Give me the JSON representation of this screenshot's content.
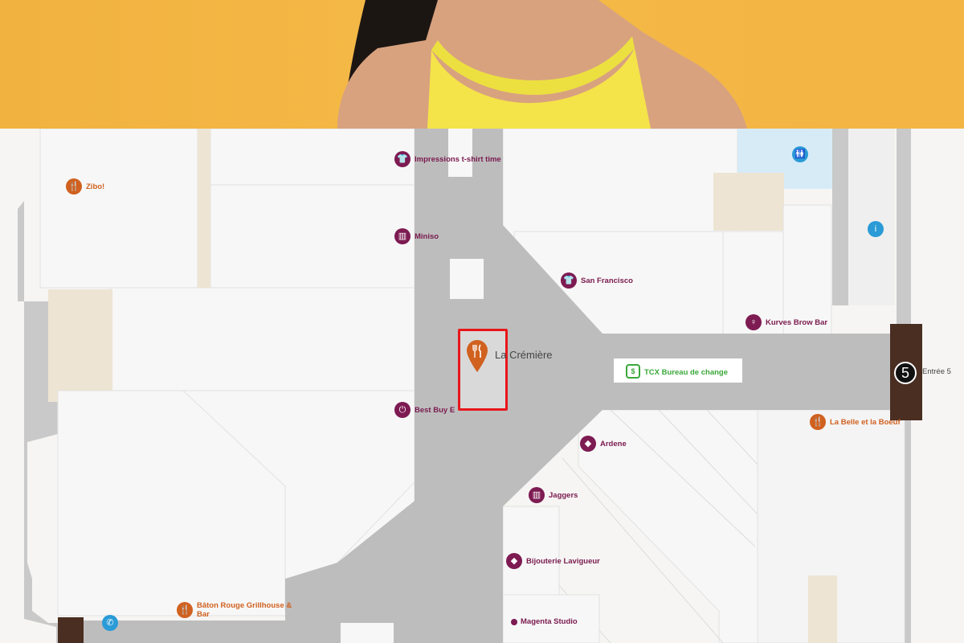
{
  "colors": {
    "shop": "#7d1b52",
    "food": "#d0611f",
    "info": "#2a9bd6",
    "exchange": "#3aa83a",
    "selection": "#e8161b",
    "banner": "#f3b544"
  },
  "selected_store": {
    "name": "La Crémière",
    "icon": "fork-knife-icon"
  },
  "entrance": {
    "number": "5",
    "label": "Entrée 5"
  },
  "stores": [
    {
      "name": "Impressions t-shirt time",
      "icon": "tshirt-icon"
    },
    {
      "name": "Zibo!",
      "icon": "fork-knife-icon"
    },
    {
      "name": "Miniso",
      "icon": "book-icon"
    },
    {
      "name": "San Francisco",
      "icon": "tshirt-icon"
    },
    {
      "name": "Kurves Brow Bar",
      "icon": "beauty-icon"
    },
    {
      "name": "TCX Bureau de change",
      "icon": "dollar-icon"
    },
    {
      "name": "Best Buy E",
      "icon": "plug-icon"
    },
    {
      "name": "La Belle et la Boeuf",
      "icon": "fork-knife-icon"
    },
    {
      "name": "Ardene",
      "icon": "diamond-icon"
    },
    {
      "name": "Jaggers",
      "icon": "book-icon"
    },
    {
      "name": "Bijouterie Lavigueur",
      "icon": "diamond-icon"
    },
    {
      "name": "Bâton Rouge Grillhouse & Bar",
      "icon": "fork-knife-icon"
    },
    {
      "name": "Magenta Studio",
      "icon": "dot-icon"
    }
  ],
  "amenities": [
    {
      "name": "restroom",
      "icon": "restroom-icon"
    },
    {
      "name": "information",
      "icon": "info-icon"
    },
    {
      "name": "phone",
      "icon": "phone-icon"
    }
  ]
}
